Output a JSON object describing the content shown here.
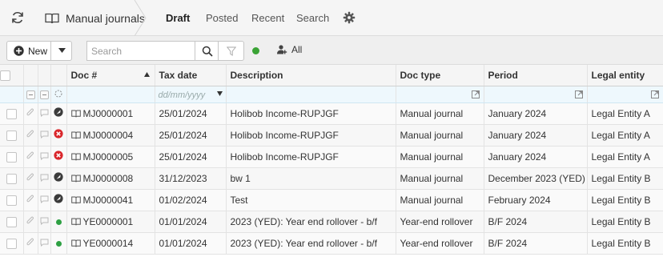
{
  "nav": {
    "breadcrumb_title": "Manual journals",
    "tabs": [
      {
        "label": "Draft",
        "active": true
      },
      {
        "label": "Posted",
        "active": false
      },
      {
        "label": "Recent",
        "active": false
      },
      {
        "label": "Search",
        "active": false
      }
    ]
  },
  "toolbar": {
    "new_label": "New",
    "search_placeholder": "Search",
    "status_color": "#3aa335",
    "users_label": "All"
  },
  "grid": {
    "columns": [
      "Doc #",
      "Tax date",
      "Description",
      "Doc type",
      "Period",
      "Legal entity"
    ],
    "filter": {
      "tax_date_placeholder": "dd/mm/yyyy"
    },
    "rows": [
      {
        "status": "approved",
        "doc": "MJ0000001",
        "tax_date": "25/01/2024",
        "description": "Holibob Income-RUPJGF",
        "doc_type": "Manual journal",
        "period": "January 2024",
        "entity": "Legal Entity A"
      },
      {
        "status": "error",
        "doc": "MJ0000004",
        "tax_date": "25/01/2024",
        "description": "Holibob Income-RUPJGF",
        "doc_type": "Manual journal",
        "period": "January 2024",
        "entity": "Legal Entity A"
      },
      {
        "status": "error",
        "doc": "MJ0000005",
        "tax_date": "25/01/2024",
        "description": "Holibob Income-RUPJGF",
        "doc_type": "Manual journal",
        "period": "January 2024",
        "entity": "Legal Entity A"
      },
      {
        "status": "approved",
        "doc": "MJ0000008",
        "tax_date": "31/12/2023",
        "description": "bw 1",
        "doc_type": "Manual journal",
        "period": "December 2023 (YED)",
        "entity": "Legal Entity B"
      },
      {
        "status": "approved",
        "doc": "MJ0000041",
        "tax_date": "01/02/2024",
        "description": "Test",
        "doc_type": "Manual journal",
        "period": "February 2024",
        "entity": "Legal Entity B"
      },
      {
        "status": "ready",
        "doc": "YE0000001",
        "tax_date": "01/01/2024",
        "description": "2023 (YED): Year end rollover - b/f",
        "doc_type": "Year-end rollover",
        "period": "B/F 2024",
        "entity": "Legal Entity B"
      },
      {
        "status": "ready",
        "doc": "YE0000014",
        "tax_date": "01/01/2024",
        "description": "2023 (YED): Year end rollover - b/f",
        "doc_type": "Year-end rollover",
        "period": "B/F 2024",
        "entity": "Legal Entity B"
      }
    ]
  }
}
